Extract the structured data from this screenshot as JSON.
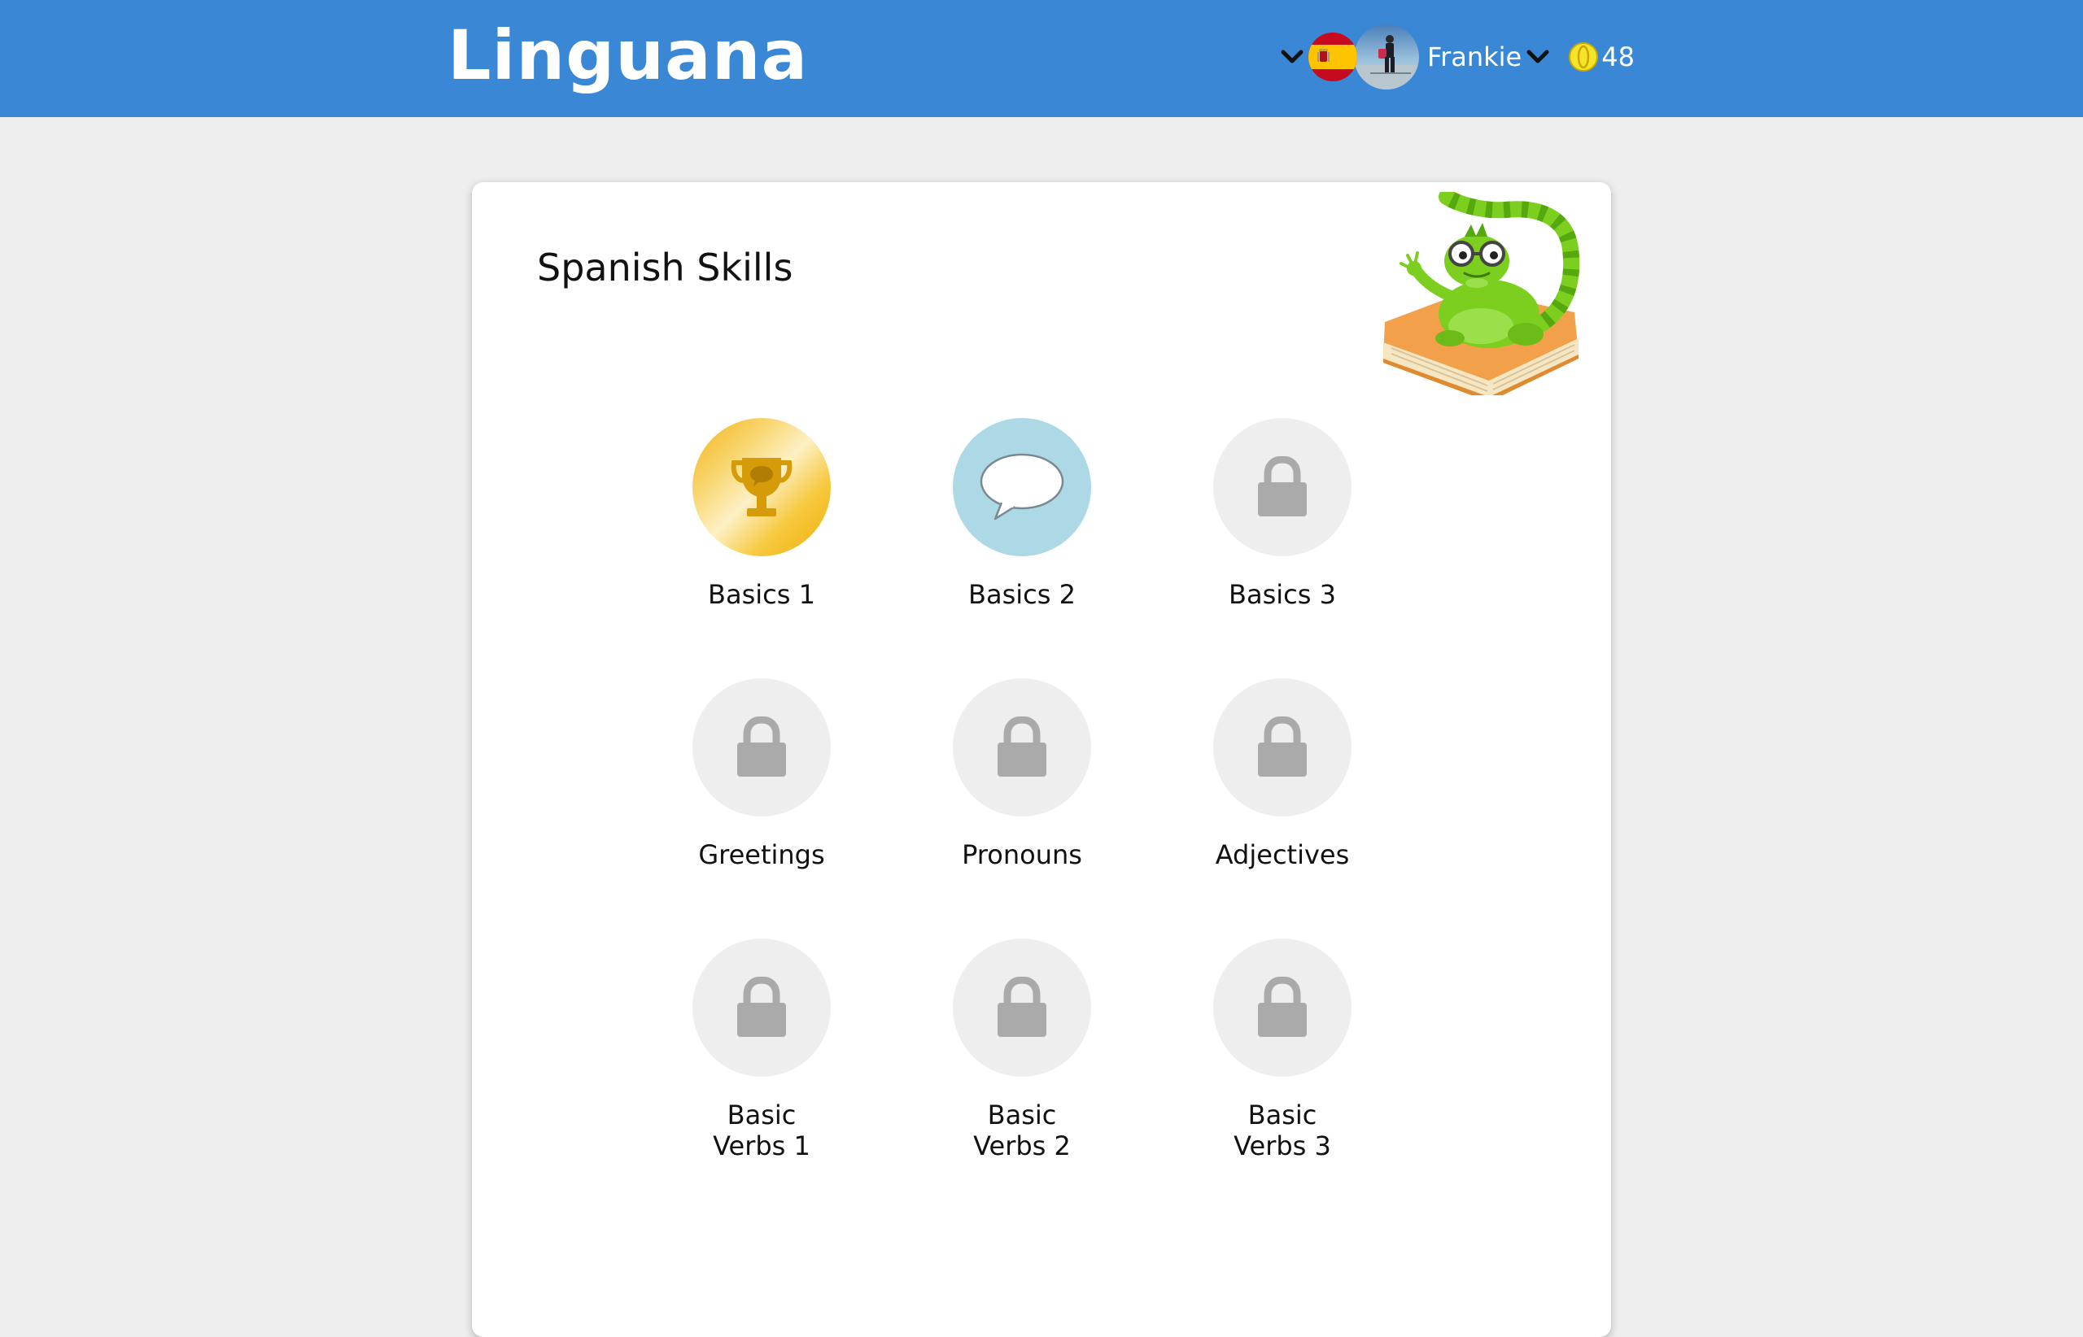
{
  "header": {
    "brand": "Linguana",
    "language_flag_icon": "spain-flag-icon",
    "username": "Frankie",
    "coin_count": "48",
    "bar_color": "#3a87d6"
  },
  "main": {
    "title": "Spanish Skills",
    "skills": [
      {
        "label": "Basics 1",
        "state": "completed",
        "icon": "trophy-icon"
      },
      {
        "label": "Basics 2",
        "state": "unlocked",
        "icon": "speech-bubble-icon"
      },
      {
        "label": "Basics 3",
        "state": "locked",
        "icon": "lock-icon"
      },
      {
        "label": "Greetings",
        "state": "locked",
        "icon": "lock-icon"
      },
      {
        "label": "Pronouns",
        "state": "locked",
        "icon": "lock-icon"
      },
      {
        "label": "Adjectives",
        "state": "locked",
        "icon": "lock-icon"
      },
      {
        "label_line1": "Basic",
        "label_line2": "Verbs 1",
        "state": "locked",
        "icon": "lock-icon"
      },
      {
        "label_line1": "Basic",
        "label_line2": "Verbs 2",
        "state": "locked",
        "icon": "lock-icon"
      },
      {
        "label_line1": "Basic",
        "label_line2": "Verbs 3",
        "state": "locked",
        "icon": "lock-icon"
      }
    ]
  },
  "colors": {
    "page_background": "#eeeeee",
    "locked_circle": "#eeeeee",
    "lock_icon": "#aaaaaa",
    "unlocked_circle": "#add8e6",
    "completed_gold": "#f2b312"
  }
}
